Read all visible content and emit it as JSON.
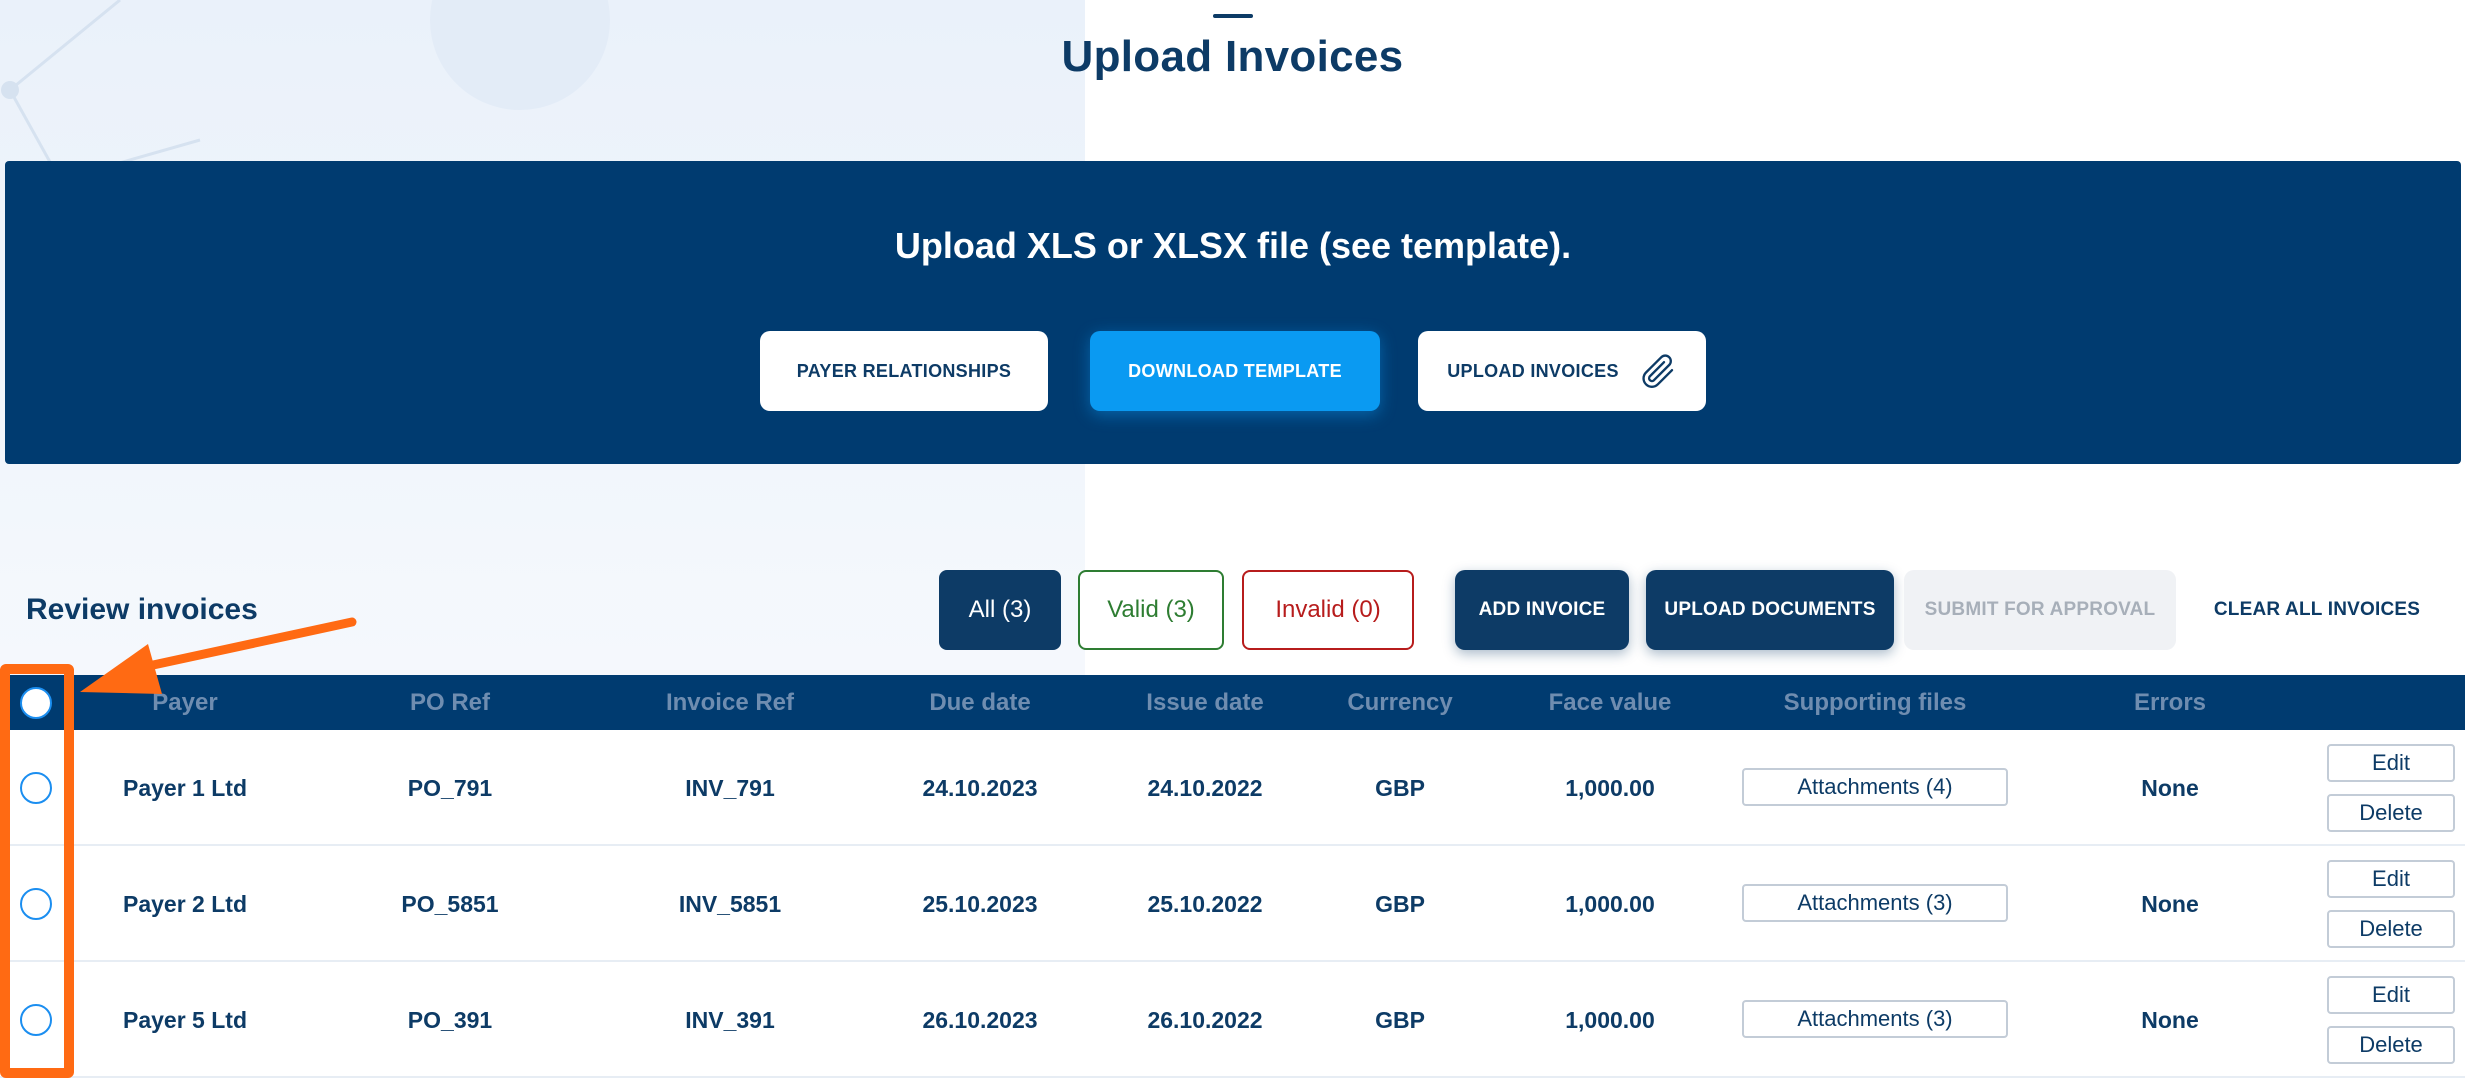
{
  "page": {
    "title": "Upload Invoices"
  },
  "upload_panel": {
    "heading": "Upload XLS or XLSX file (see template).",
    "buttons": {
      "payer_relationships": "PAYER RELATIONSHIPS",
      "download_template": "DOWNLOAD TEMPLATE",
      "upload_invoices": "UPLOAD INVOICES"
    },
    "upload_icon": "paperclip-icon"
  },
  "review": {
    "title": "Review invoices",
    "filters": {
      "all": "All (3)",
      "valid": "Valid (3)",
      "invalid": "Invalid (0)"
    },
    "actions": {
      "add_invoice": "ADD INVOICE",
      "upload_documents": "UPLOAD DOCUMENTS",
      "submit_for_approval": "SUBMIT FOR APPROVAL",
      "clear_all": "CLEAR ALL INVOICES"
    },
    "columns": [
      "Payer",
      "PO Ref",
      "Invoice Ref",
      "Due date",
      "Issue date",
      "Currency",
      "Face value",
      "Supporting files",
      "Errors"
    ],
    "rows": [
      {
        "payer": "Payer 1 Ltd",
        "po_ref": "PO_791",
        "invoice_ref": "INV_791",
        "due_date": "24.10.2023",
        "issue_date": "24.10.2022",
        "currency": "GBP",
        "face_value": "1,000.00",
        "attachments": "Attachments (4)",
        "errors": "None",
        "edit": "Edit",
        "delete": "Delete"
      },
      {
        "payer": "Payer 2 Ltd",
        "po_ref": "PO_5851",
        "invoice_ref": "INV_5851",
        "due_date": "25.10.2023",
        "issue_date": "25.10.2022",
        "currency": "GBP",
        "face_value": "1,000.00",
        "attachments": "Attachments (3)",
        "errors": "None",
        "edit": "Edit",
        "delete": "Delete"
      },
      {
        "payer": "Payer 5 Ltd",
        "po_ref": "PO_391",
        "invoice_ref": "INV_391",
        "due_date": "26.10.2023",
        "issue_date": "26.10.2022",
        "currency": "GBP",
        "face_value": "1,000.00",
        "attachments": "Attachments (3)",
        "errors": "None",
        "edit": "Edit",
        "delete": "Delete"
      }
    ]
  },
  "colors": {
    "navy": "#003b70",
    "accent_blue": "#0a9af2",
    "valid_green": "#2e7d32",
    "invalid_red": "#b71c1c",
    "annotation_orange": "#ff6a13"
  }
}
